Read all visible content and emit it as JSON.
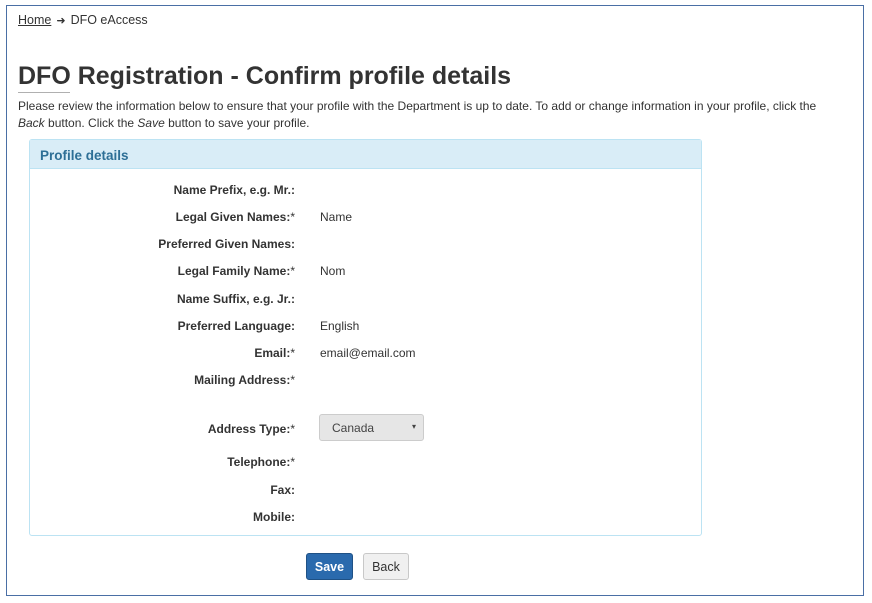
{
  "breadcrumb": {
    "home": "Home",
    "separator": "➜",
    "current": "DFO eAccess"
  },
  "page": {
    "title": "DFO Registration - Confirm profile details",
    "intro_part1": "Please review the information below to ensure that your profile with the Department is up to date. To add or change information in your profile, click the ",
    "intro_back": "Back",
    "intro_part2": " button. Click the ",
    "intro_save": "Save",
    "intro_part3": " button to save your profile."
  },
  "panel": {
    "title": "Profile details",
    "rows": [
      {
        "label": "Name Prefix, e.g. Mr.:",
        "required": "",
        "value": ""
      },
      {
        "label": "Legal Given Names:",
        "required": "*",
        "value": "Name"
      },
      {
        "label": "Preferred Given Names:",
        "required": "",
        "value": ""
      },
      {
        "label": "Legal Family Name:",
        "required": "*",
        "value": "Nom"
      },
      {
        "label": "Name Suffix, e.g. Jr.:",
        "required": "",
        "value": ""
      },
      {
        "label": "Preferred Language:",
        "required": "",
        "value": "English"
      },
      {
        "label": "Email:",
        "required": "*",
        "value": "email@email.com"
      },
      {
        "label": "Mailing Address:",
        "required": "*",
        "value": ""
      },
      {
        "label": "Address Type:",
        "required": "*",
        "value": "Canada"
      },
      {
        "label": "Telephone:",
        "required": "*",
        "value": ""
      },
      {
        "label": "Fax:",
        "required": "",
        "value": ""
      },
      {
        "label": "Mobile:",
        "required": "",
        "value": ""
      }
    ]
  },
  "select": {
    "caret": "▾"
  },
  "buttons": {
    "save": "Save",
    "back": "Back"
  },
  "colors": {
    "primary": "#2a6aad",
    "panel_heading": "#d9edf7",
    "panel_title": "#2d6f96"
  }
}
